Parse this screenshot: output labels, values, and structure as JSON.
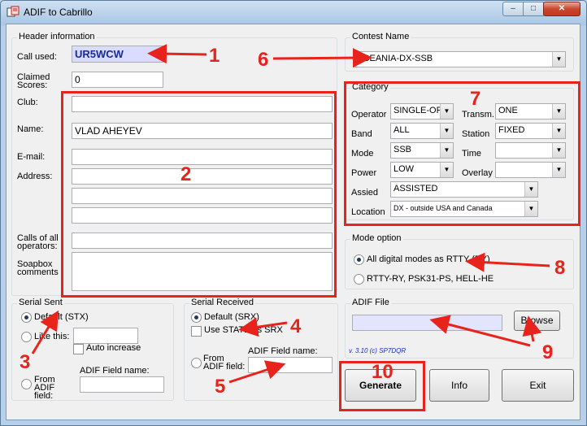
{
  "window": {
    "title": "ADIF to Cabrillo",
    "min_label": "–",
    "max_label": "□",
    "close_label": "✕"
  },
  "header": {
    "title": "Header information",
    "call_label": "Call used:",
    "call_value": "UR5WCW",
    "claimed_label": "Claimed Scores:",
    "claimed_value": "0",
    "club_label": "Club:",
    "club_value": "",
    "name_label": "Name:",
    "name_value": "VLAD AHEYEV",
    "email_label": "E-mail:",
    "address_label": "Address:",
    "calls_label": "Calls of all operators:",
    "soapbox_label": "Soapbox comments"
  },
  "contest": {
    "title": "Contest Name",
    "value": "OCEANIA-DX-SSB"
  },
  "category": {
    "title": "Category",
    "operator_label": "Operator",
    "operator_value": "SINGLE-OP",
    "band_label": "Band",
    "band_value": "ALL",
    "mode_label": "Mode",
    "mode_value": "SSB",
    "power_label": "Power",
    "power_value": "LOW",
    "assisted_label": "Assied",
    "assisted_value": "ASSISTED",
    "location_label": "Location",
    "location_value": "DX  - outside USA and Canada",
    "transm_label": "Transm.",
    "transm_value": "ONE",
    "station_label": "Station",
    "station_value": "FIXED",
    "time_label": "Time",
    "time_value": "",
    "overlay_label": "Overlay",
    "overlay_value": ""
  },
  "mode_option": {
    "title": "Mode option",
    "option1": "All digital modes as RTTY (RY)",
    "option2": "RTTY-RY, PSK31-PS, HELL-HE"
  },
  "serial_sent": {
    "title": "Serial Sent",
    "default_label": "Default (STX)",
    "like_label": "Like this:",
    "auto_label": "Auto increase",
    "from_adif_label": "From ADIF field:",
    "adif_field_label": "ADIF Field name:"
  },
  "serial_received": {
    "title": "Serial Received",
    "default_label": "Default (SRX)",
    "use_state_label": "Use STATE as SRX",
    "from_adif_label": "From ADIF field:",
    "adif_field_label": "ADIF Field name:"
  },
  "adif_file": {
    "title": "ADIF File",
    "value": "",
    "browse_label": "Browse",
    "version": "v. 3.10  (c)  SP7DQR"
  },
  "buttons": {
    "generate": "Generate",
    "info": "Info",
    "exit": "Exit"
  },
  "annotations": {
    "n1": "1",
    "n2": "2",
    "n3": "3",
    "n4": "4",
    "n5": "5",
    "n6": "6",
    "n7": "7",
    "n8": "8",
    "n9": "9",
    "n10": "10"
  },
  "colors": {
    "annotation": "#e8231c",
    "call_field_bg": "#d9dcff",
    "call_text": "#1a2b9a"
  }
}
